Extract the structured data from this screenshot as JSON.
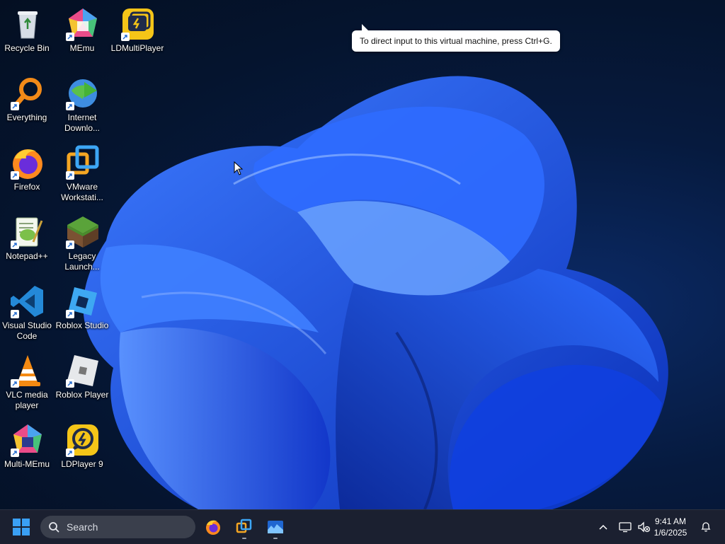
{
  "desktop": {
    "icons": [
      {
        "label": "Recycle Bin"
      },
      {
        "label": "MEmu"
      },
      {
        "label": "LDMultiPlayer"
      },
      {
        "label": "Everything"
      },
      {
        "label": "Internet Downlo..."
      },
      {
        "label": "Firefox"
      },
      {
        "label": "VMware Workstati..."
      },
      {
        "label": "Notepad++"
      },
      {
        "label": "Legacy Launch..."
      },
      {
        "label": "Visual Studio Code"
      },
      {
        "label": "Roblox Studio"
      },
      {
        "label": "VLC media player"
      },
      {
        "label": "Roblox Player"
      },
      {
        "label": "Multi-MEmu"
      },
      {
        "label": "LDPlayer 9"
      }
    ]
  },
  "tooltip": {
    "text": "To direct input to this virtual machine, press Ctrl+G."
  },
  "taskbar": {
    "search_placeholder": "Search",
    "pinned": [
      "firefox-icon",
      "vmware-icon",
      "wallpaper-app-icon"
    ],
    "clock": {
      "time": "9:41 AM",
      "date": "1/6/2025"
    }
  },
  "colors": {
    "accent": "#1e6bff",
    "taskbar": "#1b2030"
  }
}
